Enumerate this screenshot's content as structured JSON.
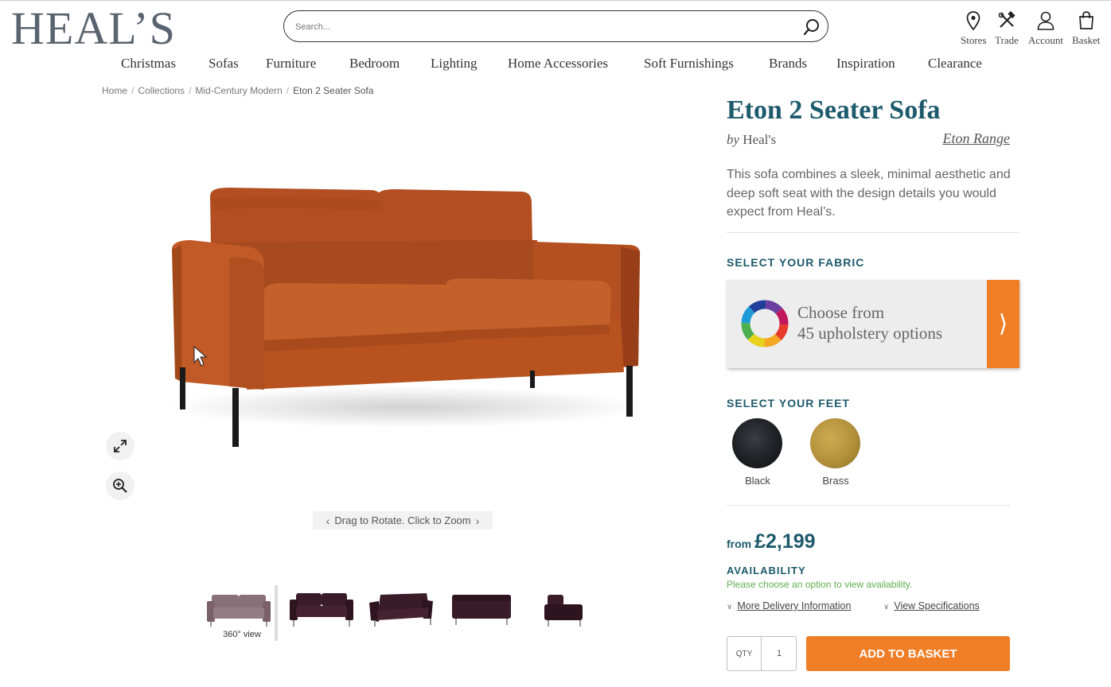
{
  "header": {
    "logo": "HEAL’S",
    "search": {
      "placeholder": "Search...",
      "value": ""
    },
    "utilities": [
      {
        "label": "Stores",
        "icon": "pin-icon"
      },
      {
        "label": "Trade",
        "icon": "tools-icon"
      },
      {
        "label": "Account",
        "icon": "user-icon"
      },
      {
        "label": "Basket",
        "icon": "bag-icon"
      }
    ]
  },
  "nav": [
    "Christmas",
    "Sofas",
    "Furniture",
    "Bedroom",
    "Lighting",
    "Home Accessories",
    "Soft Furnishings",
    "Brands",
    "Inspiration",
    "Clearance"
  ],
  "breadcrumb": [
    "Home",
    "Collections",
    "Mid-Century Modern",
    "Eton 2 Seater Sofa"
  ],
  "viewer": {
    "hint": "Drag to Rotate. Click to Zoom",
    "tools": [
      "expand-icon",
      "zoom-in-icon"
    ],
    "thumbnails": [
      {
        "caption": "360° view",
        "color": "#8a7078"
      },
      {
        "caption": "",
        "color": "#3a1c28"
      },
      {
        "caption": "",
        "color": "#3a1c28"
      },
      {
        "caption": "",
        "color": "#3a1c28"
      },
      {
        "caption": "",
        "color": "#3a1c28"
      }
    ]
  },
  "product": {
    "title": "Eton 2 Seater Sofa",
    "by_prefix": "by",
    "brand": "Heal's",
    "range_link": "Eton Range",
    "description": "This sofa combines a sleek, minimal aesthetic and deep soft seat with the design details you would expect from Heal’s.",
    "fabric": {
      "heading": "SELECT YOUR FABRIC",
      "line1": "Choose from",
      "line2": "45 upholstery options",
      "arrow": "⟩"
    },
    "feet": {
      "heading": "SELECT YOUR FEET",
      "options": [
        {
          "label": "Black",
          "color": "#1e2024"
        },
        {
          "label": "Brass",
          "color": "#b3913a"
        }
      ]
    },
    "price": {
      "from": "from",
      "amount": "£2,199"
    },
    "availability": {
      "heading": "AVAILABILITY",
      "message": "Please choose an option to view availability."
    },
    "links": {
      "delivery": "More Delivery Information",
      "specs": "View Specifications"
    },
    "qty": {
      "label": "QTY",
      "value": "1"
    },
    "add_to_basket": "ADD TO BASKET"
  },
  "colors": {
    "brand_teal": "#1d5a6b",
    "accent_orange": "#f07e26",
    "sofa": "#bd5426",
    "availability_green": "#5fae50"
  }
}
